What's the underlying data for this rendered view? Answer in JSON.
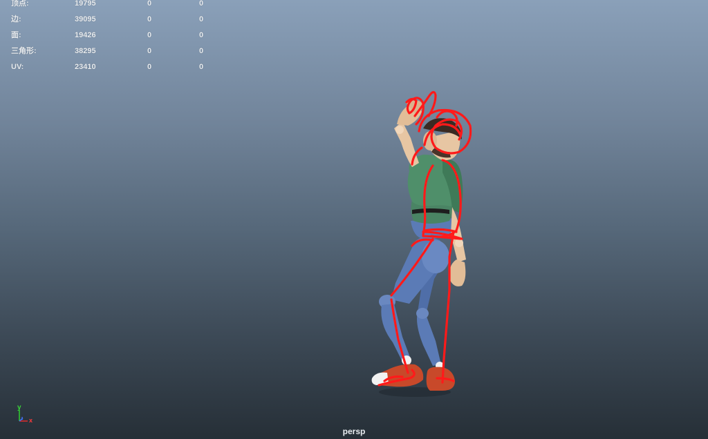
{
  "hud": {
    "rows": [
      {
        "label": "顶点:",
        "total": "19795",
        "selected": "0",
        "component": "0"
      },
      {
        "label": "边:",
        "total": "39095",
        "selected": "0",
        "component": "0"
      },
      {
        "label": "面:",
        "total": "19426",
        "selected": "0",
        "component": "0"
      },
      {
        "label": "三角形:",
        "total": "38295",
        "selected": "0",
        "component": "0"
      },
      {
        "label": "UV:",
        "total": "23410",
        "selected": "0",
        "component": "0"
      }
    ]
  },
  "axis": {
    "y": "y",
    "x": "x",
    "z": "z"
  },
  "camera": {
    "name": "persp"
  },
  "colors": {
    "gradient_top": "#8aa0b9",
    "gradient_bottom": "#262f37",
    "stroke": "#ff1a1a",
    "shirt": "#4f8f6a",
    "pants": "#5b7bb6",
    "shoes": "#cc4a2a",
    "skin": "#e7c6a3",
    "hair": "#3a2a22"
  }
}
